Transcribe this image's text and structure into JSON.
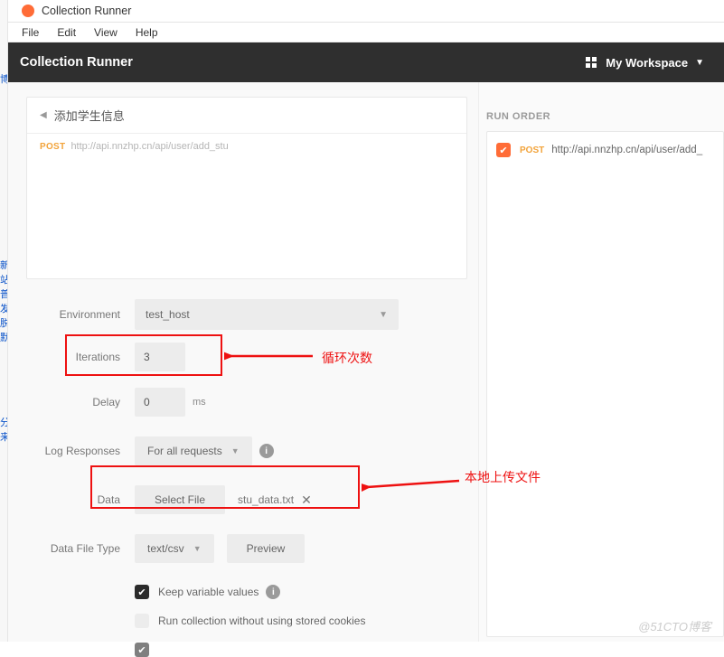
{
  "app": {
    "title": "Collection Runner"
  },
  "menu": {
    "file": "File",
    "edit": "Edit",
    "view": "View",
    "help": "Help"
  },
  "header": {
    "title": "Collection Runner",
    "workspace": "My Workspace"
  },
  "card": {
    "name": "添加学生信息",
    "req_method": "POST",
    "req_url": "http://api.nnzhp.cn/api/user/add_stu"
  },
  "form": {
    "environment_label": "Environment",
    "environment_value": "test_host",
    "iterations_label": "Iterations",
    "iterations_value": "3",
    "delay_label": "Delay",
    "delay_value": "0",
    "delay_units": "ms",
    "log_label": "Log Responses",
    "log_value": "For all requests",
    "data_label": "Data",
    "data_button": "Select File",
    "data_filename": "stu_data.txt",
    "dft_label": "Data File Type",
    "dft_value": "text/csv",
    "preview_btn": "Preview",
    "keep_vars": "Keep variable values",
    "no_cookies": "Run collection without using stored cookies"
  },
  "annotations": {
    "loop": "循环次数",
    "upload": "本地上传文件"
  },
  "side": {
    "heading": "RUN ORDER",
    "method": "POST",
    "url": "http://api.nnzhp.cn/api/user/add_"
  },
  "watermark": "@51CTO博客"
}
